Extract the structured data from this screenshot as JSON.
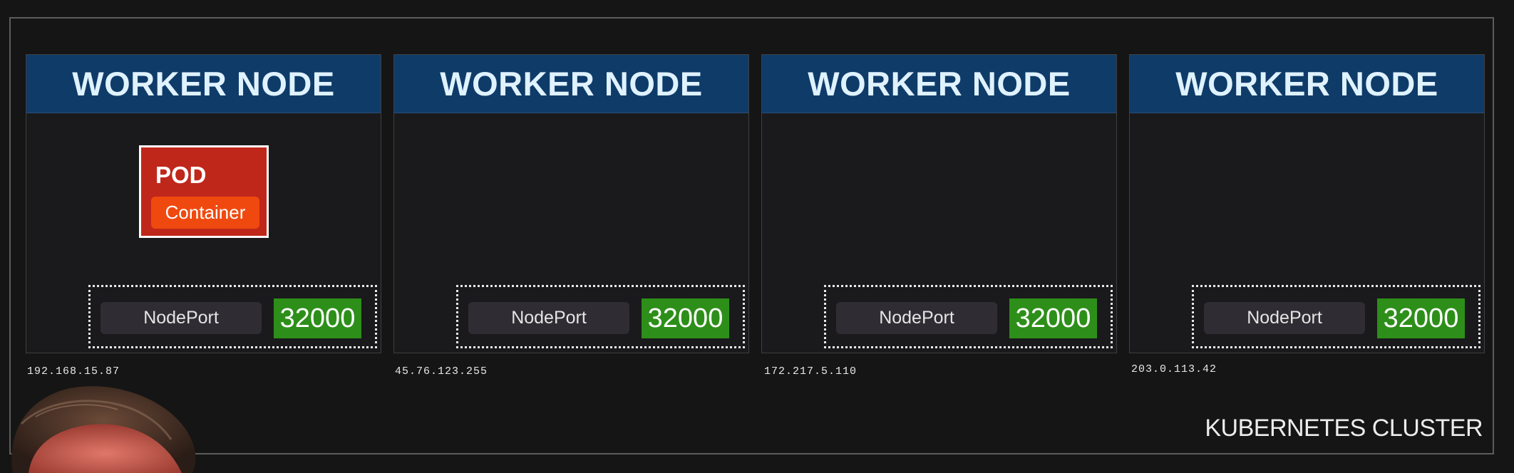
{
  "cluster": {
    "label": "KUBERNETES CLUSTER"
  },
  "nodes": [
    {
      "title": "WORKER NODE",
      "ip": "192.168.15.87",
      "nodeport_label": "NodePort",
      "port": "32000",
      "has_pod": true
    },
    {
      "title": "WORKER NODE",
      "ip": "45.76.123.255",
      "nodeport_label": "NodePort",
      "port": "32000",
      "has_pod": false
    },
    {
      "title": "WORKER NODE",
      "ip": "172.217.5.110",
      "nodeport_label": "NodePort",
      "port": "32000",
      "has_pod": false
    },
    {
      "title": "WORKER NODE",
      "ip": "203.0.113.42",
      "nodeport_label": "NodePort",
      "port": "32000",
      "has_pod": false
    }
  ],
  "pod": {
    "title": "POD",
    "container_label": "Container"
  },
  "colors": {
    "node_header": "#0f3b69",
    "pod": "#c0271b",
    "container": "#f0490f",
    "port": "#2d8f19",
    "nodeport_label": "#302c33"
  }
}
